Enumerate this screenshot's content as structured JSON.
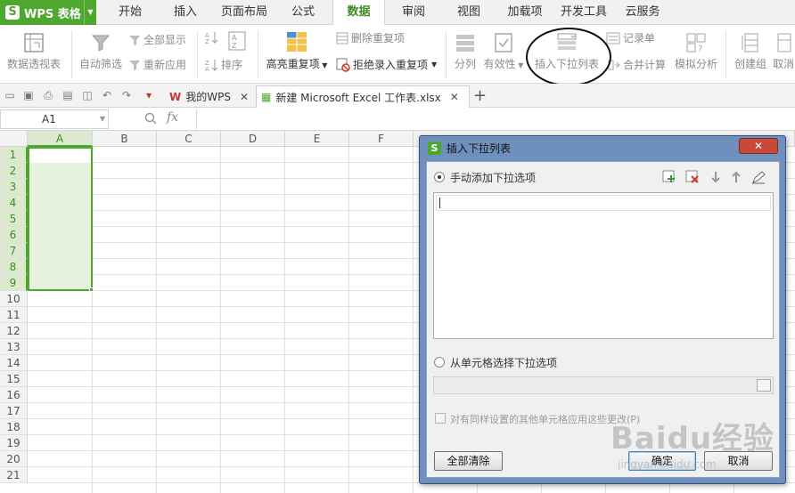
{
  "app": {
    "name": "WPS 表格",
    "logo": "S"
  },
  "menu": {
    "tabs": [
      "开始",
      "插入",
      "页面布局",
      "公式",
      "数据",
      "审阅",
      "视图",
      "加载项",
      "开发工具",
      "云服务"
    ],
    "active": "数据"
  },
  "ribbon": {
    "pivot": "数据透视表",
    "autofilter": "自动筛选",
    "show_all": "全部显示",
    "reapply": "重新应用",
    "sort": "排序",
    "highlight_dup": "高亮重复项",
    "remove_dup": "删除重复项",
    "reject_dup": "拒绝录入重复项",
    "split": "分列",
    "validity": "有效性",
    "insert_dropdown": "插入下拉列表",
    "record_form": "记录单",
    "consolidate": "合并计算",
    "simulate": "模拟分析",
    "create_group": "创建组",
    "cancel_group": "取消"
  },
  "doc_tabs": {
    "tab1": "我的WPS",
    "tab2": "新建 Microsoft Excel 工作表.xlsx"
  },
  "formula_bar": {
    "name_box": "A1",
    "fx": "fx"
  },
  "grid": {
    "columns": [
      "A",
      "B",
      "C",
      "D",
      "E",
      "F"
    ],
    "rows": [
      "1",
      "2",
      "3",
      "4",
      "5",
      "6",
      "7",
      "8",
      "9",
      "10",
      "11",
      "12",
      "13",
      "14",
      "15",
      "16",
      "17",
      "18",
      "19",
      "20",
      "21"
    ]
  },
  "dialog": {
    "logo": "S",
    "title": "插入下拉列表",
    "close": "✕",
    "manual_option": "手动添加下拉选项",
    "cell_option": "从单元格选择下拉选项",
    "apply_all": "对有同样设置的其他单元格应用这些更改(P)",
    "clear_all": "全部清除",
    "ok": "确定",
    "cancel": "取消"
  },
  "watermark": {
    "big": "Baidu经验",
    "small": "jingyan.baidu.com"
  },
  "colors": {
    "accent": "#4ea72e",
    "dialog_frame": "#6f90bd",
    "close_button": "#c8483a"
  }
}
